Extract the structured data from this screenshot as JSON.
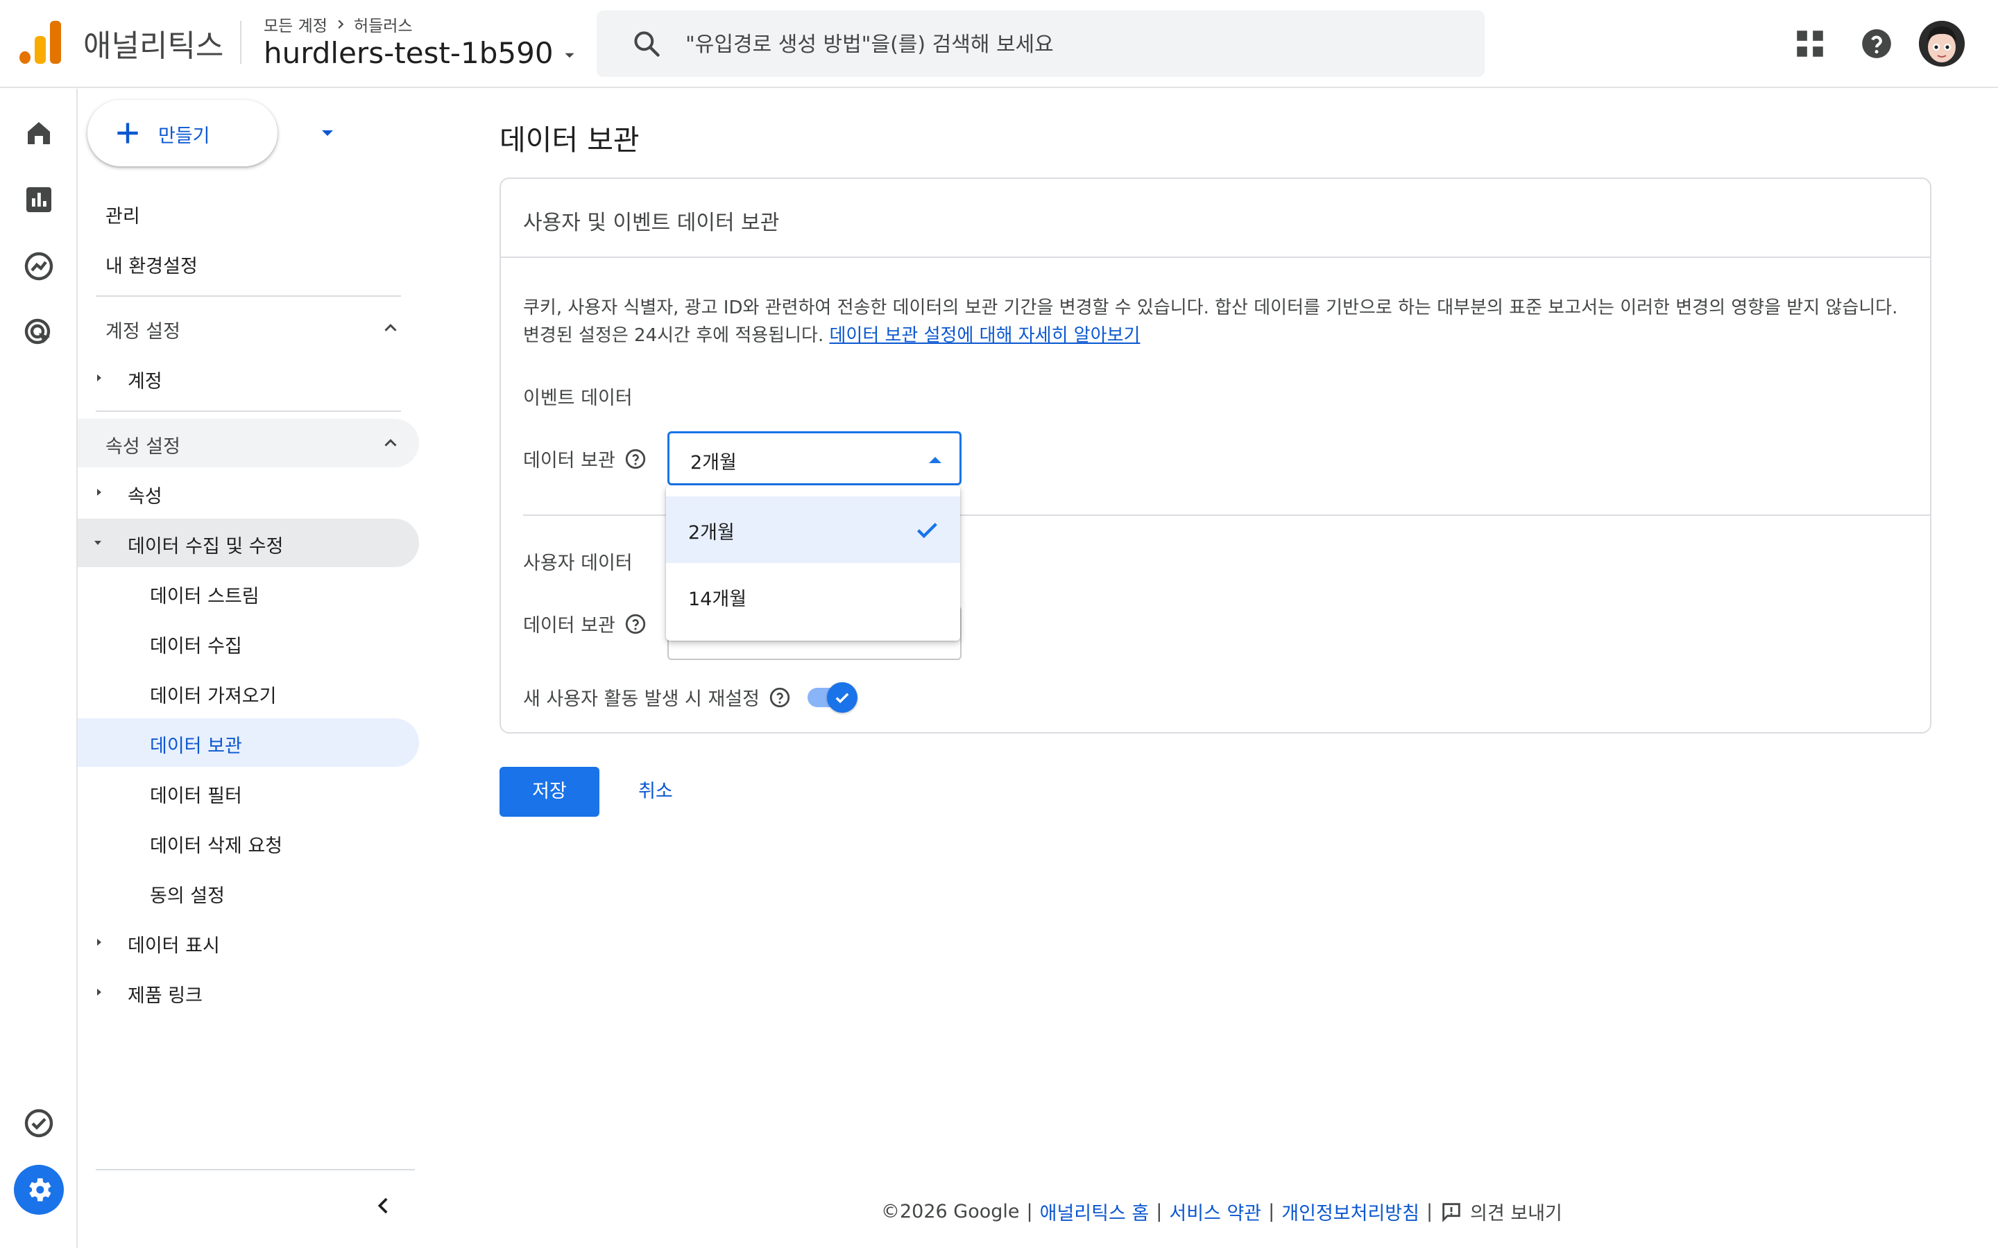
{
  "header": {
    "app_name": "애널리틱스",
    "crumb_all_accounts": "모든 계정",
    "crumb_account": "허들러스",
    "property_name": "hurdlers-test-1b590",
    "search_placeholder": "\"유입경로 생성 방법\"을(를) 검색해 보세요"
  },
  "icons": {
    "apps": "apps-grid-icon",
    "help": "help-icon",
    "search": "search-icon",
    "settings": "gear-icon"
  },
  "colors": {
    "accent": "#1a73e8",
    "logo_orange": "#f9ab00",
    "logo_dark_orange": "#e37400",
    "selected_bg": "#e8f0fe",
    "nav_active_bg": "#e9eef6"
  },
  "sidebar": {
    "create_label": "만들기",
    "admin": "관리",
    "my_settings": "내 환경설정",
    "account_settings_head": "계정 설정",
    "account": "계정",
    "property_settings_head": "속성 설정",
    "property": "속성",
    "data_collection": "데이터 수집 및 수정",
    "sub_items": [
      "데이터 스트림",
      "데이터 수집",
      "데이터 가져오기",
      "데이터 보관",
      "데이터 필터",
      "데이터 삭제 요청",
      "동의 설정"
    ],
    "data_display": "데이터 표시",
    "product_links": "제품 링크"
  },
  "main": {
    "page_title": "데이터 보관",
    "card_title": "사용자 및 이벤트 데이터 보관",
    "description_line1": "쿠키, 사용자 식별자, 광고 ID와 관련하여 전송한 데이터의 보관 기간을 변경할 수 있습니다. 합산 데이터를 기반으로 하는 대부분의 표준 보고서는 이러한 변경의 영향을 받지 않습니다.",
    "description_line2": "변경된 설정은 24시간 후에 적용됩니다.",
    "learn_more": "데이터 보관 설정에 대해 자세히 알아보기",
    "event_data_head": "이벤트 데이터",
    "event_retention_label": "데이터 보관",
    "event_retention_value": "2개월",
    "user_data_head": "사용자 데이터",
    "user_retention_label": "데이터 보관",
    "reset_label": "새 사용자 활동 발생 시 재설정",
    "reset_enabled": true,
    "dropdown_options": [
      {
        "label": "2개월",
        "selected": true
      },
      {
        "label": "14개월",
        "selected": false
      }
    ],
    "save_label": "저장",
    "cancel_label": "취소"
  },
  "footer": {
    "copyright": "©2026 Google",
    "sep": "|",
    "home": "애널리틱스 홈",
    "terms": "서비스 약관",
    "privacy": "개인정보처리방침",
    "feedback": "의견 보내기"
  }
}
